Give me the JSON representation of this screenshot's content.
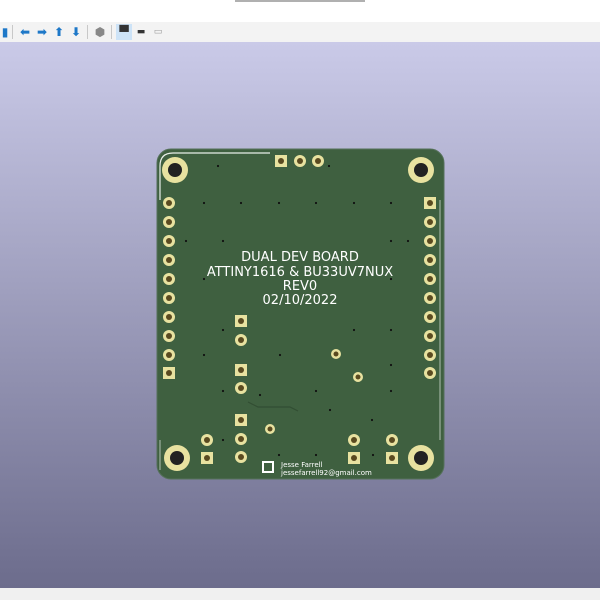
{
  "toolbar": {
    "items": [
      "render-icon",
      "arrow-left-icon",
      "arrow-right-icon",
      "arrow-up-icon",
      "arrow-down-icon",
      "3d-box-icon",
      "top-view-icon",
      "bottom-view-icon",
      "grid-view-icon"
    ]
  },
  "board": {
    "silkscreen": [
      "DUAL DEV BOARD",
      "ATTINY1616 & BU33UV7NUX",
      "REV0",
      "02/10/2022"
    ],
    "author": "Jesse Farrell",
    "email": "jessefarrell92@gmail.com"
  },
  "colors": {
    "board": "#3f6040",
    "pad": "#e8e2a0",
    "silk": "#ffffff"
  }
}
